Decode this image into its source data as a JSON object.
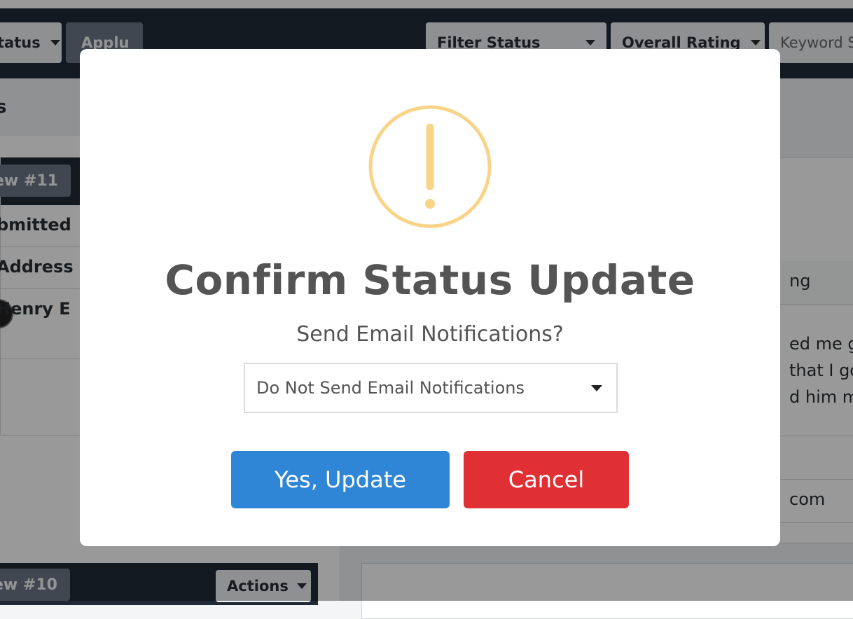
{
  "toolbar": {
    "status_dropdown_label": "tatus",
    "apply_label": "Applu",
    "filter_status_label": "Filter Status",
    "overall_rating_label": "Overall Rating",
    "keyword_label": "Keyword S"
  },
  "left_panel": {
    "header_fragment": "s",
    "review_card_1": {
      "badge": "ew #11",
      "rows": {
        "submitted": "bmitted",
        "address": "Address"
      },
      "person_name": "Henry E"
    },
    "review_card_2": {
      "badge": "ew #10",
      "actions_label": "Actions"
    }
  },
  "right_panel": {
    "rating_fragment": "ng",
    "text_lines": [
      "ed me ge",
      "that I got",
      "d him mo"
    ],
    "email_fragment": "com"
  },
  "modal": {
    "title": "Confirm Status Update",
    "subtitle": "Send Email Notifications?",
    "select_value": "Do Not Send Email Notifications",
    "confirm_label": "Yes, Update",
    "cancel_label": "Cancel"
  },
  "icons": {
    "warning": "exclamation-circle-icon",
    "dropdown": "caret-down-icon"
  },
  "colors": {
    "confirm_button": "#2f86d6",
    "cancel_button": "#e03034",
    "warning_icon": "#f8d488",
    "toolbar": "#1f2a36"
  }
}
